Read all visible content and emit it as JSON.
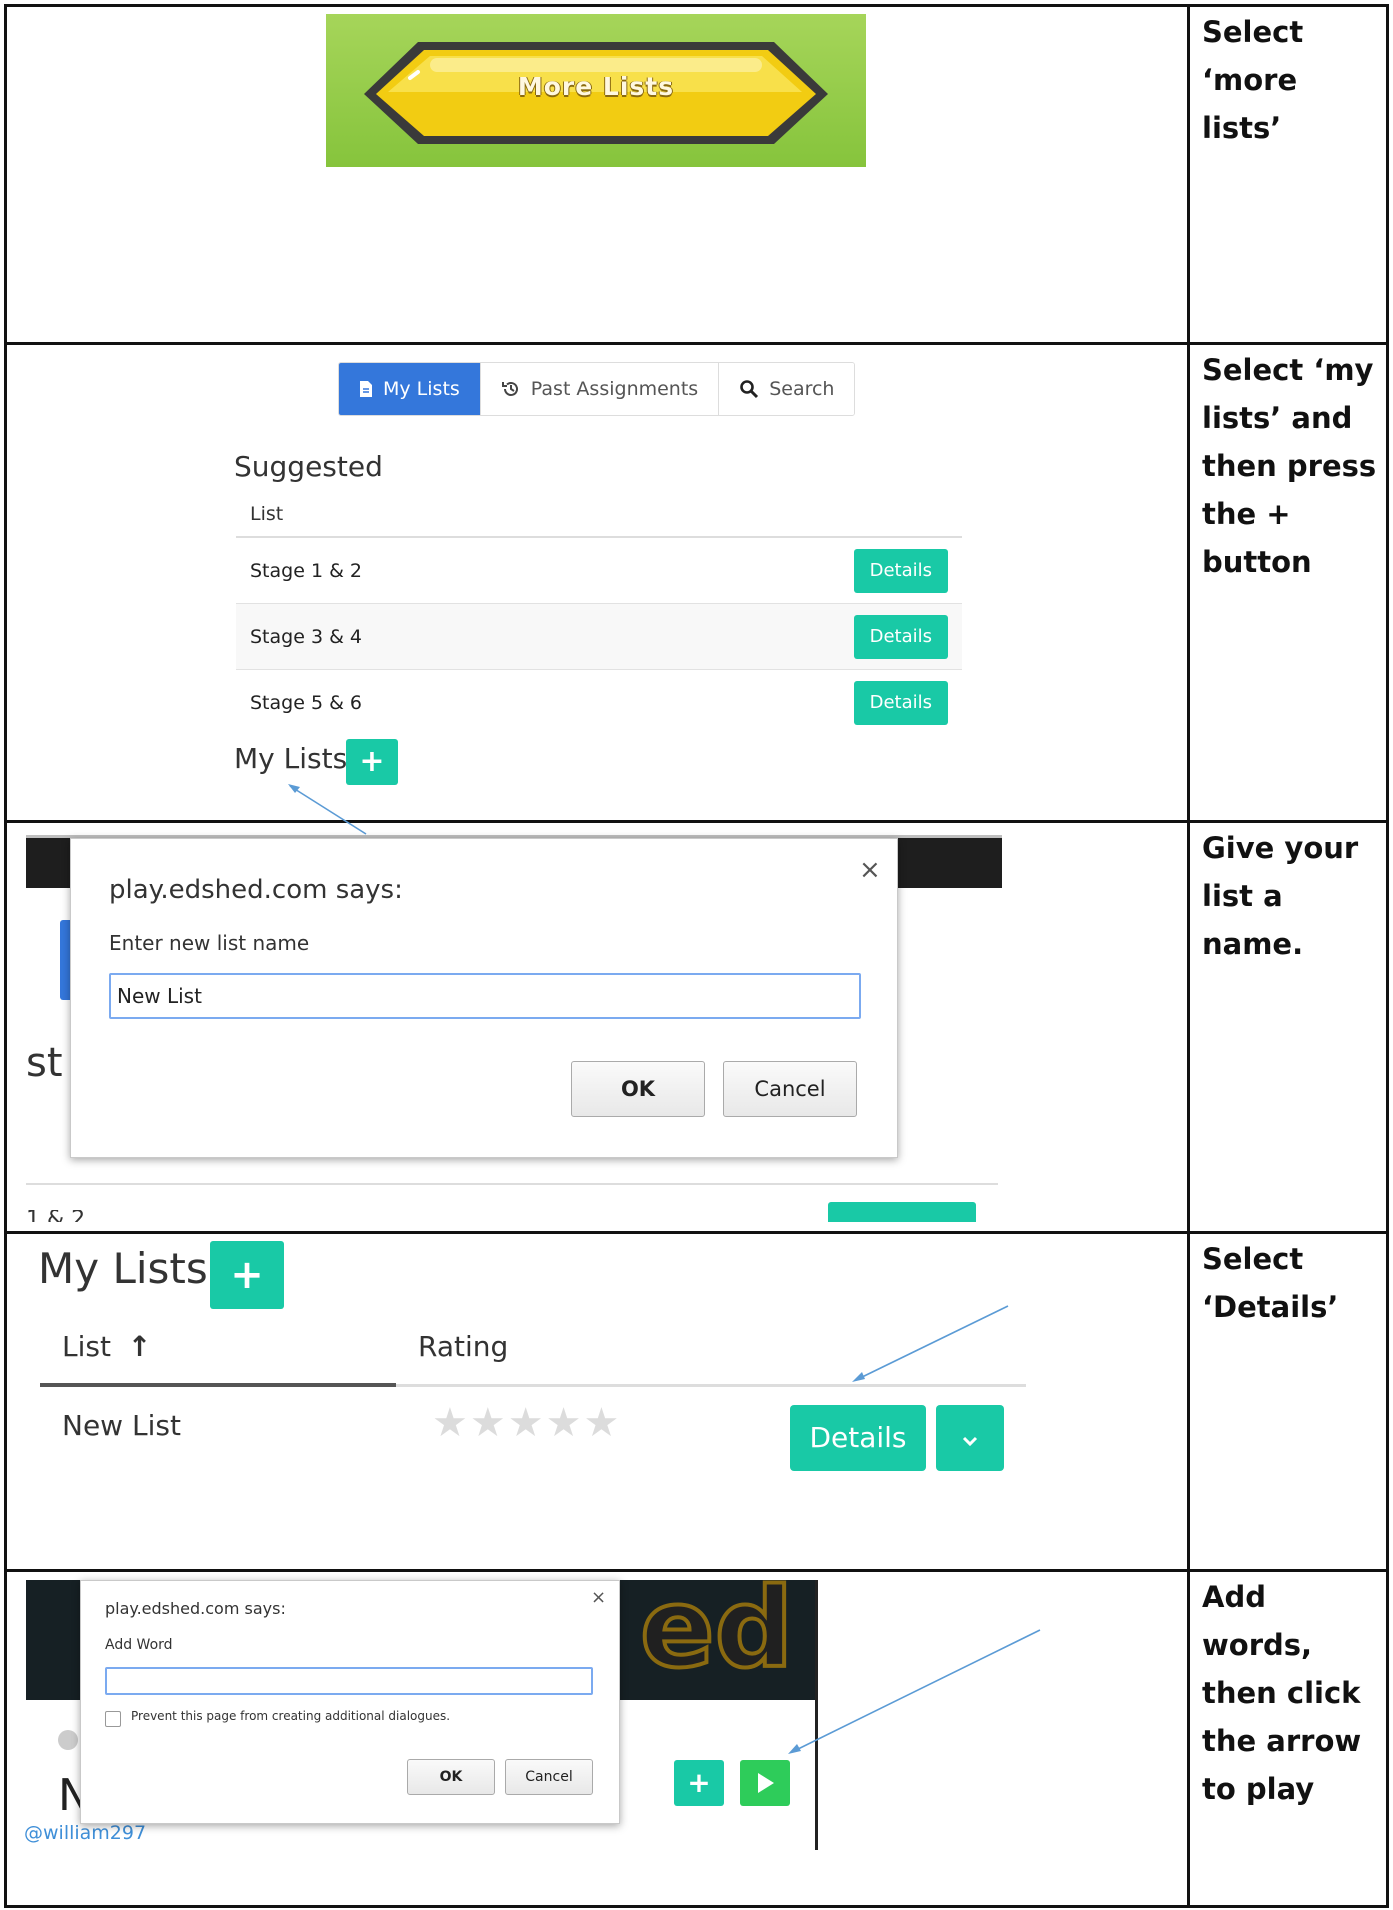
{
  "instructions": [
    "Select ‘more lists’",
    "Select ‘my lists’ and then press the + button",
    "Give your list a name.",
    "Select ‘Details’",
    "Add words, then click the arrow to play"
  ],
  "step1": {
    "banner_label": "More Lists"
  },
  "step2": {
    "tabs": [
      {
        "label": "My Lists",
        "icon": "file-icon"
      },
      {
        "label": "Past Assignments",
        "icon": "history-icon"
      },
      {
        "label": "Search",
        "icon": "search-icon"
      }
    ],
    "suggested_title": "Suggested",
    "column_header": "List",
    "rows": [
      {
        "name": "Stage 1 & 2",
        "button": "Details"
      },
      {
        "name": "Stage 3 & 4",
        "button": "Details"
      },
      {
        "name": "Stage 5 & 6",
        "button": "Details"
      }
    ],
    "my_lists_title": "My Lists",
    "plus_label": "+"
  },
  "step3": {
    "dialog_title": "play.edshed.com says:",
    "prompt": "Enter new list name",
    "input_value": "New List",
    "ok_label": "OK",
    "cancel_label": "Cancel",
    "close_glyph": "×",
    "bg_fragment": "st",
    "bg_row_fragment": "1 & 2"
  },
  "step4": {
    "my_lists_title": "My Lists",
    "plus_label": "+",
    "col_list": "List",
    "sort_arrow": "↑",
    "col_rating": "Rating",
    "row_name": "New List",
    "stars": "★★★★★",
    "details_label": "Details",
    "dropdown_glyph": "˅"
  },
  "step5": {
    "dialog_title": "play.edshed.com says:",
    "prompt": "Add Word",
    "input_value": "",
    "checkbox_label": "Prevent this page from creating additional dialogues.",
    "ok_label": "OK",
    "cancel_label": "Cancel",
    "close_glyph": "×",
    "username": "@william297",
    "bg_letter": "N",
    "bg_logo_fragment": "ed",
    "plus_label": "+"
  },
  "colors": {
    "accent_teal": "#19c9a6",
    "tab_blue": "#3477db",
    "play_green": "#2ecc5a",
    "banner_green": "#8cc63f",
    "arrow_blue": "#5b9bd5"
  }
}
